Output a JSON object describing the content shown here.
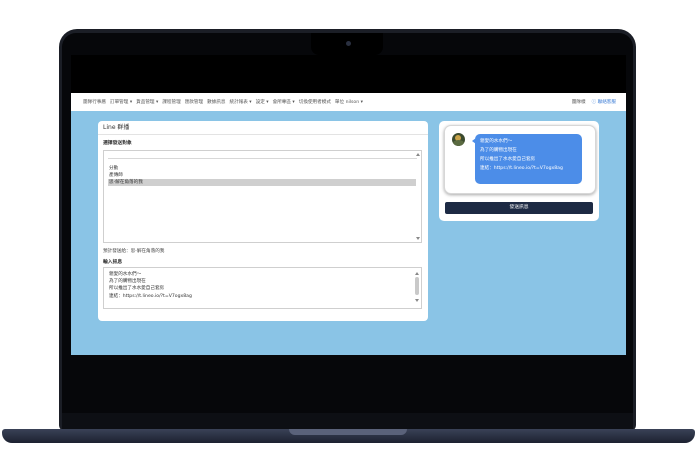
{
  "nav": {
    "items": [
      "團隊行事曆",
      "訂單管理 ▾",
      "貨品管理 ▾",
      "課程管理",
      "匯款管理",
      "數據訊息",
      "統計報表 ▾",
      "設定 ▾",
      "會所專區 ▾",
      "切換使用者模式",
      "單位 nilson ▾"
    ],
    "right_link": "團隊樣",
    "help_link": "ⓘ 聯絡客服"
  },
  "left_card": {
    "title": "Line 群播",
    "recipients_label": "選擇發送對象",
    "options": [
      "分動",
      "產傳師",
      "思-解在角落的我"
    ],
    "selected_index": 2,
    "preview": "預計發送給：思-解在角落的我",
    "message_label": "輸入訊息",
    "message_lines": [
      "親愛的水水們～",
      "為了的購物出現在",
      "所以推出了水水愛自己套房",
      "連結：https://t.lineo.io/?t=V7ogx8ag"
    ]
  },
  "right_card": {
    "bubble_lines": [
      "親愛的水水們～",
      "為了的購物出現在",
      "所以推出了水水愛自己套房",
      "連結：https://t.lineo.io/?t=V7ogx8ag"
    ],
    "send_label": "發送訊息"
  },
  "colors": {
    "background": "#8ac4e6",
    "bubble": "#4c8de8",
    "button": "#1d2a44"
  }
}
